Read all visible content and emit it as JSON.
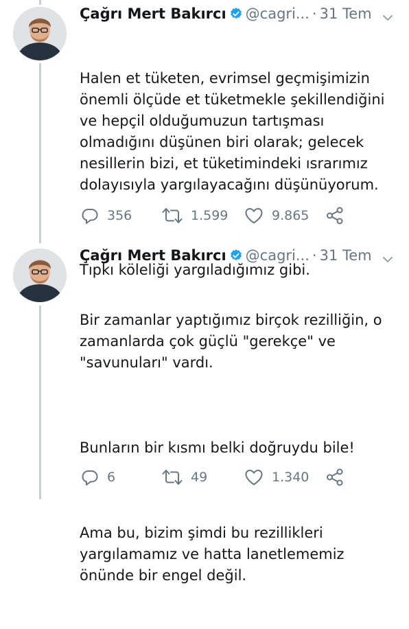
{
  "tweets": [
    {
      "author_name": "Çağrı Mert Bakırcı",
      "handle": "@cagri...",
      "separator": "·",
      "date": "31 Tem",
      "paragraphs": [
        "Halen et tüketen, evrimsel geçmişimizin önemli ölçüde et tüketmekle şekillendiğini ve hepçil olduğumuzun tartışması olmadığını düşünen biri olarak; gelecek nesillerin bizi, et tüketimindeki ısrarımız dolayısıyla yargılayacağını düşünüyorum.",
        "Tıpkı köleliği yargıladığımız gibi."
      ],
      "replies": "356",
      "retweets": "1.599",
      "likes": "9.865"
    },
    {
      "author_name": "Çağrı Mert Bakırcı",
      "handle": "@cagri...",
      "separator": "·",
      "date": "31 Tem",
      "paragraphs": [
        "Bir zamanlar yaptığımız birçok rezilliğin, o zamanlarda çok güçlü \"gerekçe\" ve \"savunuları\" vardı.",
        "Bunların bir kısmı belki doğruydu bile!",
        "Ama bu, bizim şimdi bu rezillikleri yargılamamız ve hatta lanetlememiz önünde bir engel değil."
      ],
      "replies": "6",
      "retweets": "49",
      "likes": "1.340"
    }
  ],
  "icons": {
    "verified": "verified-badge-icon",
    "caret": "chevron-down-icon",
    "reply": "reply-icon",
    "retweet": "retweet-icon",
    "like": "heart-icon",
    "share": "share-icon"
  },
  "colors": {
    "verified": "#1da1f2",
    "muted": "#657786",
    "thread_line": "#c4cfd6"
  }
}
